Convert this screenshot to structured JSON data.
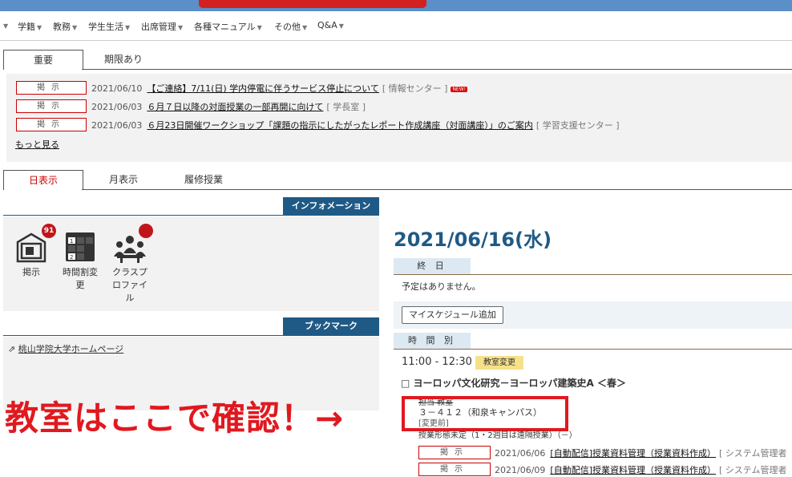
{
  "menu": [
    {
      "label": "学籍"
    },
    {
      "label": "教務"
    },
    {
      "label": "学生生活"
    },
    {
      "label": "出席管理"
    },
    {
      "label": "各種マニュアル"
    },
    {
      "label": "その他"
    },
    {
      "label": "Q&A"
    }
  ],
  "notice_tabs": [
    "重要",
    "期限あり"
  ],
  "notices": [
    {
      "badge": "掲示",
      "date": "2021/06/10",
      "title": "【ご連絡】7/11(日) 学内停電に伴うサービス停止について",
      "source": "[ 情報センター ]",
      "is_new": true,
      "new_label": "NEW!"
    },
    {
      "badge": "掲示",
      "date": "2021/06/03",
      "title": "６月７日以降の対面授業の一部再開に向けて",
      "source": "[ 学長室 ]",
      "is_new": false
    },
    {
      "badge": "掲示",
      "date": "2021/06/03",
      "title": "６月23日開催ワークショップ「課題の指示にしたがったレポート作成講座（対面講座）」のご案内",
      "source": "[ 学習支援センター ]",
      "is_new": false
    }
  ],
  "more_link": "もっと見る",
  "view_tabs": [
    "日表示",
    "月表示",
    "履修授業"
  ],
  "info": {
    "header": "インフォメーション",
    "icons": [
      {
        "label": "掲示",
        "badge": "91"
      },
      {
        "label": "時間割変更",
        "badge": ""
      },
      {
        "label": "クラスプロファイル",
        "badge": ""
      }
    ]
  },
  "bookmark": {
    "header": "ブックマーク",
    "link": "桃山学院大学ホームページ"
  },
  "schedule": {
    "date": "2021/06/16(水)",
    "allday_label": "終 日",
    "no_plan": "予定はありません。",
    "add_button": "マイスケジュール追加",
    "timeslot_label": "時 間 別",
    "time": "11:00 - 12:30",
    "tag": "教室変更",
    "course": "ヨーロッパ文化研究－ヨーロッパ建築史A ＜春＞",
    "room_label": "担当  教室",
    "room": "３－４１２（和泉キャンパス）",
    "room_note": "[変更前]",
    "mode": "授業形態未定（1・2週目は遠隔授業）（－）",
    "posts": [
      {
        "badge": "掲示",
        "date": "2021/06/06",
        "title": "[自動配信]授業資料管理（授業資料作成）",
        "source": "[ システム管理者"
      },
      {
        "badge": "掲示",
        "date": "2021/06/09",
        "title": "[自動配信]授業資料管理（授業資料作成）",
        "source": "[ システム管理者"
      }
    ]
  },
  "annotation": {
    "text": "教室はここで確認！→"
  },
  "colors": {
    "accent": "#1f5a86",
    "alert": "#e0191f",
    "topbar": "#5b8fc7"
  }
}
